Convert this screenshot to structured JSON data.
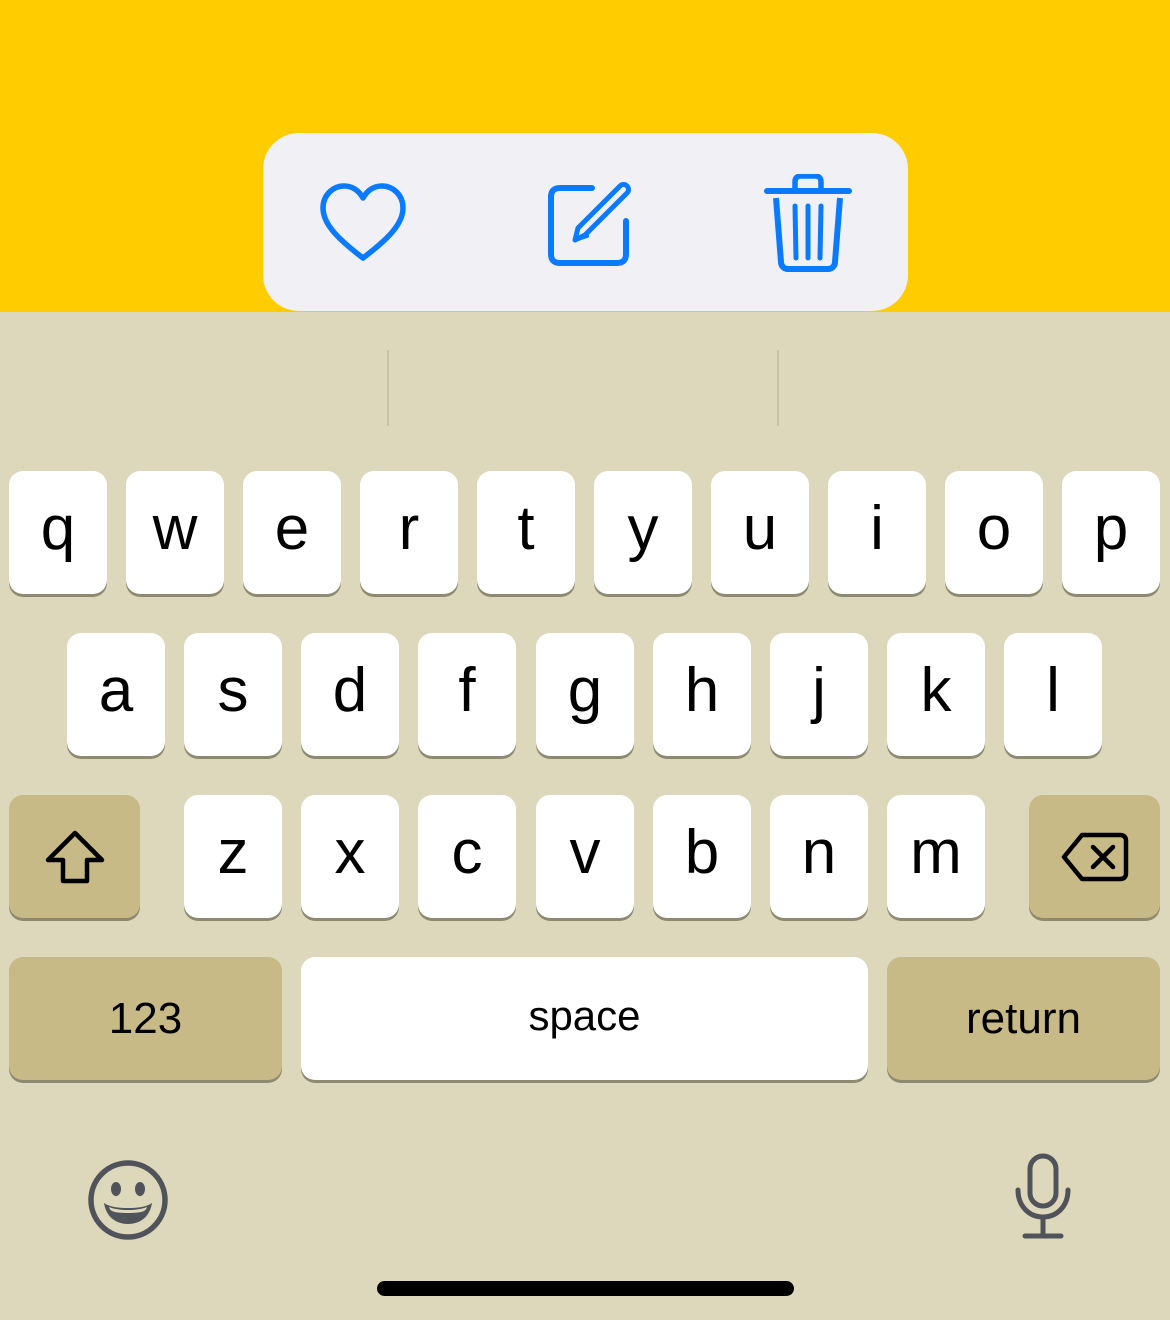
{
  "colors": {
    "app_background": "#FFCC00",
    "toolbar_background": "#F1F1F5",
    "toolbar_icon": "#0A7AFF",
    "keyboard_background": "#DDD8BB",
    "key_background": "#FFFFFF",
    "function_key_background": "#C7BA86",
    "bottom_icon": "#50545A"
  },
  "toolbar": {
    "icons": [
      "heart-icon",
      "compose-icon",
      "trash-icon"
    ]
  },
  "keyboard": {
    "row1": [
      "q",
      "w",
      "e",
      "r",
      "t",
      "y",
      "u",
      "i",
      "o",
      "p"
    ],
    "row2": [
      "a",
      "s",
      "d",
      "f",
      "g",
      "h",
      "j",
      "k",
      "l"
    ],
    "row3": [
      "z",
      "x",
      "c",
      "v",
      "b",
      "n",
      "m"
    ],
    "shift_icon": "shift-arrow-icon",
    "delete_icon": "backspace-icon",
    "numbers_label": "123",
    "space_label": "space",
    "return_label": "return",
    "emoji_icon": "emoji-icon",
    "dictation_icon": "microphone-icon"
  }
}
